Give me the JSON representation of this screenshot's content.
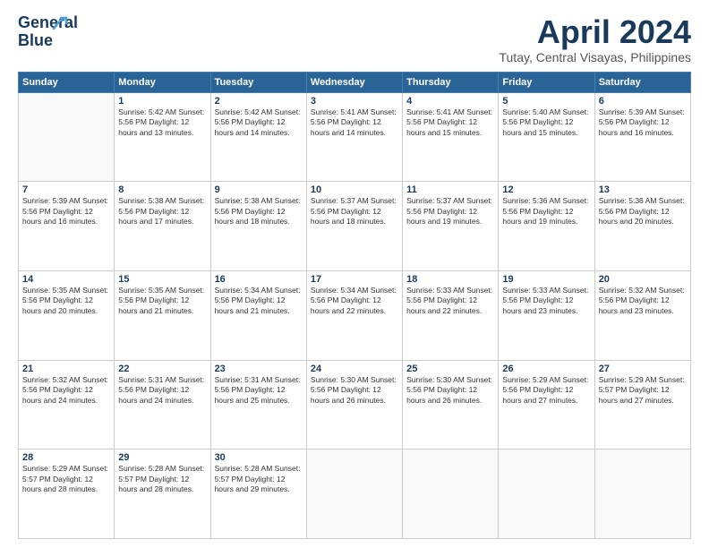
{
  "logo": {
    "line1": "General",
    "line2": "Blue"
  },
  "title": "April 2024",
  "subtitle": "Tutay, Central Visayas, Philippines",
  "header": {
    "days": [
      "Sunday",
      "Monday",
      "Tuesday",
      "Wednesday",
      "Thursday",
      "Friday",
      "Saturday"
    ]
  },
  "weeks": [
    [
      {
        "day": "",
        "info": ""
      },
      {
        "day": "1",
        "info": "Sunrise: 5:42 AM\nSunset: 5:56 PM\nDaylight: 12 hours\nand 13 minutes."
      },
      {
        "day": "2",
        "info": "Sunrise: 5:42 AM\nSunset: 5:56 PM\nDaylight: 12 hours\nand 14 minutes."
      },
      {
        "day": "3",
        "info": "Sunrise: 5:41 AM\nSunset: 5:56 PM\nDaylight: 12 hours\nand 14 minutes."
      },
      {
        "day": "4",
        "info": "Sunrise: 5:41 AM\nSunset: 5:56 PM\nDaylight: 12 hours\nand 15 minutes."
      },
      {
        "day": "5",
        "info": "Sunrise: 5:40 AM\nSunset: 5:56 PM\nDaylight: 12 hours\nand 15 minutes."
      },
      {
        "day": "6",
        "info": "Sunrise: 5:39 AM\nSunset: 5:56 PM\nDaylight: 12 hours\nand 16 minutes."
      }
    ],
    [
      {
        "day": "7",
        "info": "Sunrise: 5:39 AM\nSunset: 5:56 PM\nDaylight: 12 hours\nand 16 minutes."
      },
      {
        "day": "8",
        "info": "Sunrise: 5:38 AM\nSunset: 5:56 PM\nDaylight: 12 hours\nand 17 minutes."
      },
      {
        "day": "9",
        "info": "Sunrise: 5:38 AM\nSunset: 5:56 PM\nDaylight: 12 hours\nand 18 minutes."
      },
      {
        "day": "10",
        "info": "Sunrise: 5:37 AM\nSunset: 5:56 PM\nDaylight: 12 hours\nand 18 minutes."
      },
      {
        "day": "11",
        "info": "Sunrise: 5:37 AM\nSunset: 5:56 PM\nDaylight: 12 hours\nand 19 minutes."
      },
      {
        "day": "12",
        "info": "Sunrise: 5:36 AM\nSunset: 5:56 PM\nDaylight: 12 hours\nand 19 minutes."
      },
      {
        "day": "13",
        "info": "Sunrise: 5:36 AM\nSunset: 5:56 PM\nDaylight: 12 hours\nand 20 minutes."
      }
    ],
    [
      {
        "day": "14",
        "info": "Sunrise: 5:35 AM\nSunset: 5:56 PM\nDaylight: 12 hours\nand 20 minutes."
      },
      {
        "day": "15",
        "info": "Sunrise: 5:35 AM\nSunset: 5:56 PM\nDaylight: 12 hours\nand 21 minutes."
      },
      {
        "day": "16",
        "info": "Sunrise: 5:34 AM\nSunset: 5:56 PM\nDaylight: 12 hours\nand 21 minutes."
      },
      {
        "day": "17",
        "info": "Sunrise: 5:34 AM\nSunset: 5:56 PM\nDaylight: 12 hours\nand 22 minutes."
      },
      {
        "day": "18",
        "info": "Sunrise: 5:33 AM\nSunset: 5:56 PM\nDaylight: 12 hours\nand 22 minutes."
      },
      {
        "day": "19",
        "info": "Sunrise: 5:33 AM\nSunset: 5:56 PM\nDaylight: 12 hours\nand 23 minutes."
      },
      {
        "day": "20",
        "info": "Sunrise: 5:32 AM\nSunset: 5:56 PM\nDaylight: 12 hours\nand 23 minutes."
      }
    ],
    [
      {
        "day": "21",
        "info": "Sunrise: 5:32 AM\nSunset: 5:56 PM\nDaylight: 12 hours\nand 24 minutes."
      },
      {
        "day": "22",
        "info": "Sunrise: 5:31 AM\nSunset: 5:56 PM\nDaylight: 12 hours\nand 24 minutes."
      },
      {
        "day": "23",
        "info": "Sunrise: 5:31 AM\nSunset: 5:56 PM\nDaylight: 12 hours\nand 25 minutes."
      },
      {
        "day": "24",
        "info": "Sunrise: 5:30 AM\nSunset: 5:56 PM\nDaylight: 12 hours\nand 26 minutes."
      },
      {
        "day": "25",
        "info": "Sunrise: 5:30 AM\nSunset: 5:56 PM\nDaylight: 12 hours\nand 26 minutes."
      },
      {
        "day": "26",
        "info": "Sunrise: 5:29 AM\nSunset: 5:56 PM\nDaylight: 12 hours\nand 27 minutes."
      },
      {
        "day": "27",
        "info": "Sunrise: 5:29 AM\nSunset: 5:57 PM\nDaylight: 12 hours\nand 27 minutes."
      }
    ],
    [
      {
        "day": "28",
        "info": "Sunrise: 5:29 AM\nSunset: 5:57 PM\nDaylight: 12 hours\nand 28 minutes."
      },
      {
        "day": "29",
        "info": "Sunrise: 5:28 AM\nSunset: 5:57 PM\nDaylight: 12 hours\nand 28 minutes."
      },
      {
        "day": "30",
        "info": "Sunrise: 5:28 AM\nSunset: 5:57 PM\nDaylight: 12 hours\nand 29 minutes."
      },
      {
        "day": "",
        "info": ""
      },
      {
        "day": "",
        "info": ""
      },
      {
        "day": "",
        "info": ""
      },
      {
        "day": "",
        "info": ""
      }
    ]
  ]
}
